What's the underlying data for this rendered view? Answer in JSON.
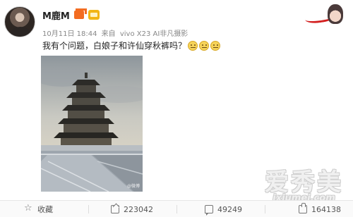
{
  "post": {
    "author": "M鹿M",
    "timestamp": "10月11日 18:44",
    "source_prefix": "来自",
    "source": "vivo X23 AI非凡摄影",
    "text": "我有个问题，白娘子和许仙穿秋裤吗？",
    "emoji_count": 3,
    "photo_watermark": "@微博"
  },
  "actions": {
    "favorite": {
      "label": "收藏",
      "icon": "star-icon"
    },
    "share": {
      "count": "223042",
      "icon": "share-icon"
    },
    "comment": {
      "count": "49249",
      "icon": "comment-icon"
    },
    "like": {
      "count": "164138",
      "icon": "like-icon"
    }
  },
  "watermark": {
    "cn": "爱秀美",
    "en": "ixiumei.com"
  },
  "colors": {
    "accent_orange": "#f36c21",
    "badge_gold": "#f2b515",
    "meta_gray": "#888888"
  }
}
